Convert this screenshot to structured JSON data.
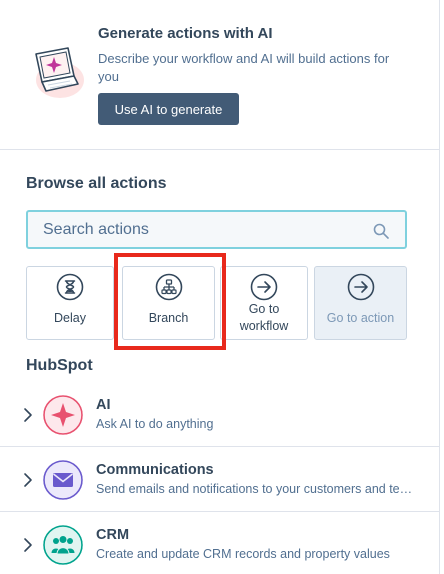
{
  "ai_promo": {
    "title": "Generate actions with AI",
    "description": "Describe your workflow and AI will build actions for you",
    "button_label": "Use AI to generate"
  },
  "browse": {
    "title": "Browse all actions",
    "search_placeholder": "Search actions"
  },
  "tiles": [
    {
      "label": "Delay",
      "icon": "hourglass-icon",
      "state": "default"
    },
    {
      "label": "Branch",
      "icon": "branch-icon",
      "state": "highlighted"
    },
    {
      "label": "Go to workflow",
      "icon": "arrow-right-circle-icon",
      "state": "default"
    },
    {
      "label": "Go to action",
      "icon": "arrow-right-circle-icon",
      "state": "disabled"
    }
  ],
  "hubspot": {
    "title": "HubSpot",
    "items": [
      {
        "title": "AI",
        "description": "Ask AI to do anything",
        "icon": "sparkle-icon",
        "color": "#e8516f"
      },
      {
        "title": "Communications",
        "description": "Send emails and notifications to your customers and team",
        "icon": "envelope-icon",
        "color": "#6a5acd"
      },
      {
        "title": "CRM",
        "description": "Create and update CRM records and property values",
        "icon": "people-icon",
        "color": "#00a38d"
      }
    ]
  },
  "colors": {
    "primary_button": "#425b76",
    "search_focus": "#7fd1de",
    "highlight_box": "#e8291c"
  }
}
